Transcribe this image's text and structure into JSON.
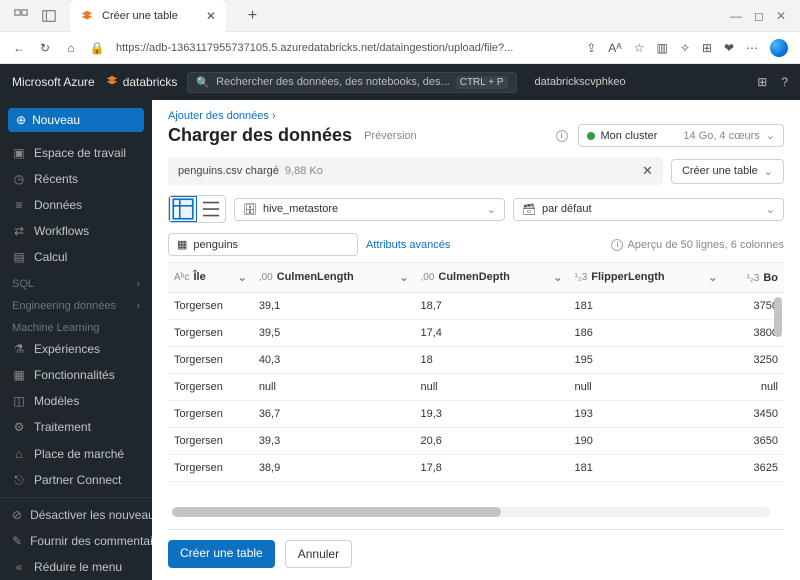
{
  "browser": {
    "tab_title": "Créer une table",
    "url": "https://adb-1363117955737105.5.azuredatabricks.net/dataingestion/upload/file?...",
    "aa_label": "Aᴬ"
  },
  "appbar": {
    "brand_ms": "Microsoft Azure",
    "brand_db": "databricks",
    "search_placeholder": "Rechercher des données, des notebooks, des...",
    "shortcut": "CTRL + P",
    "workspace": "databrickscvphkeo"
  },
  "sidebar": {
    "new_label": "Nouveau",
    "items_top": [
      {
        "label": "Espace de travail"
      },
      {
        "label": "Récents"
      },
      {
        "label": "Données"
      },
      {
        "label": "Workflows"
      },
      {
        "label": "Calcul"
      }
    ],
    "section_sql": "SQL",
    "section_eng": "Engineering données",
    "section_ml": "Machine Learning",
    "items_ml": [
      {
        "label": "Expériences"
      },
      {
        "label": "Fonctionnalités"
      },
      {
        "label": "Modèles"
      },
      {
        "label": "Traitement"
      }
    ],
    "items_bottom": [
      {
        "label": "Place de marché"
      },
      {
        "label": "Partner Connect"
      }
    ],
    "items_footer": [
      {
        "label": "Désactiver les nouveau..."
      },
      {
        "label": "Fournir des commentai..."
      },
      {
        "label": "Réduire le menu"
      }
    ]
  },
  "page": {
    "breadcrumb": "Ajouter des données",
    "title": "Charger des données",
    "preview_tag": "Préversion",
    "cluster": {
      "name": "Mon cluster",
      "spec": "14 Go, 4 cœurs"
    },
    "file": {
      "name": "penguins.csv chargé",
      "size": "9,88 Ko"
    },
    "catalog": "hive_metastore",
    "schema": "par défaut",
    "table_name": "penguins",
    "advanced_link": "Attributs avancés",
    "create_outline_btn": "Créer une table",
    "preview_info": "Aperçu de 50 lignes, 6 colonnes",
    "create_btn": "Créer une table",
    "cancel_btn": "Annuler"
  },
  "chart_data": {
    "type": "table",
    "columns": [
      {
        "name": "Île",
        "type": "Aᵇc"
      },
      {
        "name": "CulmenLength",
        "type": ",00"
      },
      {
        "name": "CulmenDepth",
        "type": ",00"
      },
      {
        "name": "FlipperLength",
        "type": "¹₂3"
      },
      {
        "name": "Bo",
        "type": "¹₂3"
      }
    ],
    "rows": [
      {
        "ile": "Torgersen",
        "cl": "39,1",
        "cd": "18,7",
        "fl": "181",
        "bo": "3750"
      },
      {
        "ile": "Torgersen",
        "cl": "39,5",
        "cd": "17,4",
        "fl": "186",
        "bo": "3800"
      },
      {
        "ile": "Torgersen",
        "cl": "40,3",
        "cd": "18",
        "fl": "195",
        "bo": "3250"
      },
      {
        "ile": "Torgersen",
        "cl": "null",
        "cd": "null",
        "fl": "null",
        "bo": "null"
      },
      {
        "ile": "Torgersen",
        "cl": "36,7",
        "cd": "19,3",
        "fl": "193",
        "bo": "3450"
      },
      {
        "ile": "Torgersen",
        "cl": "39,3",
        "cd": "20,6",
        "fl": "190",
        "bo": "3650"
      },
      {
        "ile": "Torgersen",
        "cl": "38,9",
        "cd": "17,8",
        "fl": "181",
        "bo": "3625"
      }
    ]
  }
}
